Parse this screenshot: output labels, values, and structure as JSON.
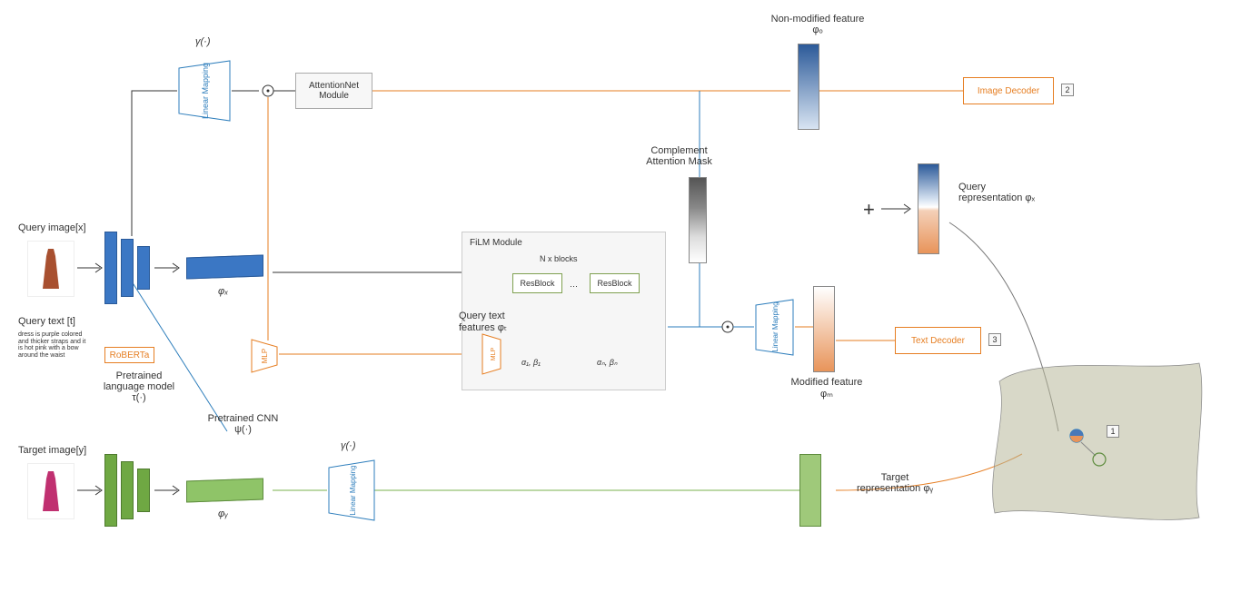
{
  "title_nonmod": "Non-modified feature φₒ",
  "title_complement": "Complement Attention Mask",
  "title_queryrep": "Query representation φₓ",
  "label_queryimg": "Query image[x]",
  "label_querytext_head": "Query text [t]",
  "label_querytext_body": "dress is purple colored and thicker straps and it is hot pink with a bow around the waist",
  "label_targetimg": "Target image[y]",
  "label_pretrained_lm": "Pretrained language model τ(·)",
  "label_pretrained_cnn": "Pretrained CNN ψ(·)",
  "label_phix": "φₓ",
  "label_phiy": "φᵧ",
  "gamma1": "γ(·)",
  "gamma2": "γ(·)",
  "linear_mapping": "Linear Mapping",
  "mlp": "MLP",
  "roberta": "RoBERTa",
  "attention_module": "AttentionNet Module",
  "image_decoder": "Image Decoder",
  "text_decoder": "Text Decoder",
  "film_module": "FiLM Module",
  "nblocks": "N x blocks",
  "resblock": "ResBlock",
  "query_text_features": "Query text features φₜ",
  "alpha1": "α₁, β₁",
  "alphan": "αₙ, βₙ",
  "modified_feature": "Modified feature φₘ",
  "target_rep": "Target representation φᵧ",
  "num1": "1",
  "num2": "2",
  "num3": "3",
  "colors": {
    "blue": "#3b77c4",
    "green": "#79b24e",
    "orange": "#e67e22",
    "darkblue": "#2c5a99"
  }
}
